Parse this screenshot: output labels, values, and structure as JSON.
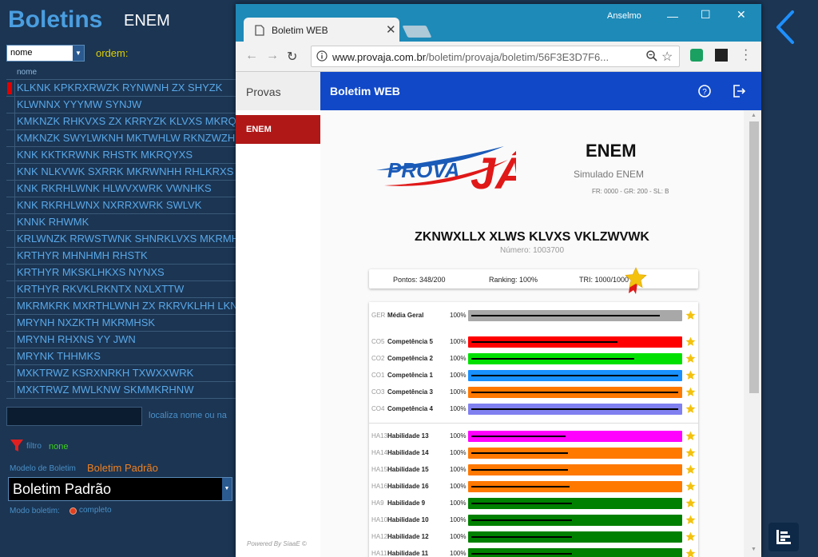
{
  "app": {
    "title": "Boletins",
    "exam": "ENEM"
  },
  "sort": {
    "value": "nome",
    "order_label": "ordem:"
  },
  "list": {
    "header": "nome",
    "items": [
      "KLKNK KPKRXRWZK RYNWNH ZX SHYZK",
      "KLWNNX YYYMW SYNJW",
      "KMKNZK RHKVXS ZX KRRYZK KLVXS MKRQYXS",
      "KMKNZK SWYLWKNH MKTWHLW RKNZWZHRNRZ",
      "KNK KKTKRWNK RHSTK MKRQYXS",
      "KNK NLKVWK SXRRK MKRWNHH RHLKRXS",
      "KNK RKRHLWNK HLWVXWRK VWNHKS",
      "KNK RKRHLWNX NXRRXWRK SWLVK",
      "KNNK RHWMK",
      "KRLWNZK RRWSTWNK SHNRKLVXS MKRMHKVXS",
      "KRTHYR MHNHMH RHSTK",
      "KRTHYR MKSKLHKXS NYNXS",
      "KRTHYR RKVKLRKNTX NXLXTTW",
      "MKRMKRK MXRTHLWNH ZX RKRVKLHH LKNH",
      "MRYNH NXZKTH MKRMHSK",
      "MRYNH RHXNS YY JWN",
      "MRYNK THHMKS",
      "MXKTRWZ KSRXNRKH TXWXXWRK",
      "MXKTRWZ MWLKNW SKMMKRHNW"
    ]
  },
  "search": {
    "value": "",
    "hint": "localiza nome ou na"
  },
  "filter": {
    "label": "filtro",
    "value": "none"
  },
  "model": {
    "label": "Modelo de Boletim",
    "value": "Boletim Padrão",
    "selected": "Boletim Padrão"
  },
  "mode": {
    "label": "Modo boletim:",
    "value": "completo"
  },
  "browser": {
    "tab_title": "Boletim WEB",
    "user": "Anselmo",
    "url_domain": "www.provaja.com.br",
    "url_path": "/boletim/provaja/boletim/56F3E3D7F6..."
  },
  "page": {
    "sidebar_title": "Provas",
    "sidebar_item": "ENEM",
    "appbar_title": "Boletim WEB",
    "powered": "Powered By SiaaE ©",
    "logo_text_left": "PROVA",
    "logo_text_right": "JÁ",
    "exam_title": "ENEM",
    "exam_subtitle": "Simulado ENEM",
    "exam_info": "FR: 0000 - GR: 200 - SL: B",
    "student_name": "ZKNWXLLX XLWS KLVXS VKLZWVWK",
    "student_number": "Número: 1003700",
    "points": "Pontos: 348/200",
    "ranking": "Ranking: 100%",
    "tri": "TRI: 1000/1000"
  },
  "bars": [
    {
      "code": "GER",
      "label": "Média Geral",
      "pct": "100%",
      "color": "#a8a8a8",
      "level": 0.9
    },
    {
      "code": "CO5",
      "label": "Competência 5",
      "pct": "100%",
      "color": "#ff0000",
      "level": 0.7
    },
    {
      "code": "CO2",
      "label": "Competência 2",
      "pct": "100%",
      "color": "#00e000",
      "level": 0.78
    },
    {
      "code": "CO1",
      "label": "Competência 1",
      "pct": "100%",
      "color": "#1890ff",
      "level": 0.99
    },
    {
      "code": "CO3",
      "label": "Competência 3",
      "pct": "100%",
      "color": "#ff7800",
      "level": 0.99
    },
    {
      "code": "CO4",
      "label": "Competência 4",
      "pct": "100%",
      "color": "#8080f0",
      "level": 0.99
    },
    {
      "code": "HA13",
      "label": "Habilidade 13",
      "pct": "100%",
      "color": "#ff00ff",
      "level": 0.45
    },
    {
      "code": "HA14",
      "label": "Habilidade 14",
      "pct": "100%",
      "color": "#ff7800",
      "level": 0.46
    },
    {
      "code": "HA15",
      "label": "Habilidade 15",
      "pct": "100%",
      "color": "#ff7800",
      "level": 0.46
    },
    {
      "code": "HA16",
      "label": "Habilidade 16",
      "pct": "100%",
      "color": "#ff7800",
      "level": 0.47
    },
    {
      "code": "HA9",
      "label": "Habilidade 9",
      "pct": "100%",
      "color": "#008000",
      "level": 0.48
    },
    {
      "code": "HA10",
      "label": "Habilidade 10",
      "pct": "100%",
      "color": "#008000",
      "level": 0.48
    },
    {
      "code": "HA12",
      "label": "Habilidade 12",
      "pct": "100%",
      "color": "#008000",
      "level": 0.48
    },
    {
      "code": "HA11",
      "label": "Habilidade 11",
      "pct": "100%",
      "color": "#008000",
      "level": 0.48
    }
  ]
}
